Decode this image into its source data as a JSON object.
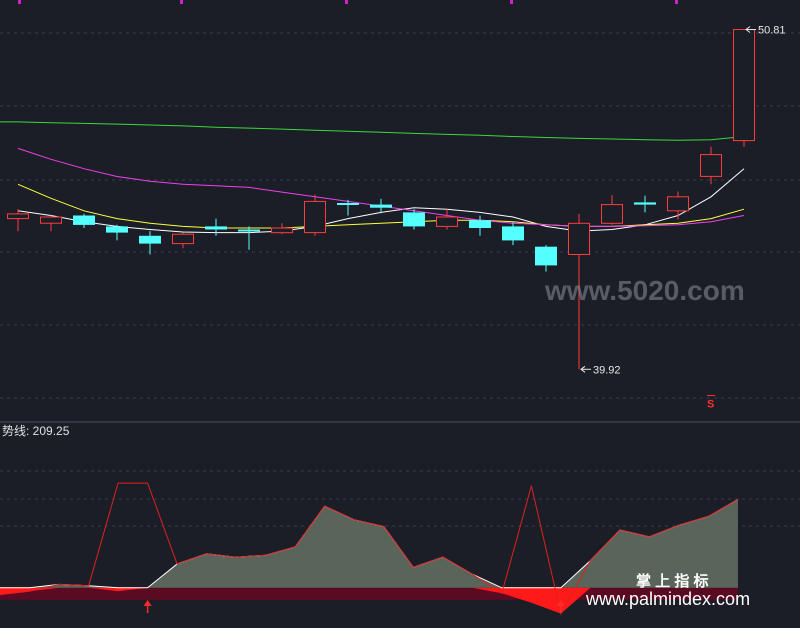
{
  "chart_data": [
    {
      "type": "candlestick",
      "title": "",
      "xlabel": "",
      "ylabel": "",
      "ylim": [
        39.0,
        51.5
      ],
      "grid": true,
      "candles": [
        {
          "open": 44.75,
          "close": 44.9,
          "high": 45.05,
          "low": 44.35
        },
        {
          "open": 44.6,
          "close": 44.8,
          "high": 44.85,
          "low": 44.35
        },
        {
          "open": 44.85,
          "close": 44.55,
          "high": 44.9,
          "low": 44.45
        },
        {
          "open": 44.5,
          "close": 44.3,
          "high": 44.55,
          "low": 44.05
        },
        {
          "open": 44.2,
          "close": 43.95,
          "high": 44.35,
          "low": 43.6
        },
        {
          "open": 43.95,
          "close": 44.25,
          "high": 44.3,
          "low": 43.8
        },
        {
          "open": 44.5,
          "close": 44.4,
          "high": 44.75,
          "low": 44.2
        },
        {
          "open": 44.4,
          "close": 44.38,
          "high": 44.5,
          "low": 43.75
        },
        {
          "open": 44.3,
          "close": 44.45,
          "high": 44.6,
          "low": 44.25
        },
        {
          "open": 44.3,
          "close": 45.3,
          "high": 45.52,
          "low": 44.2
        },
        {
          "open": 45.25,
          "close": 45.2,
          "high": 45.35,
          "low": 44.85
        },
        {
          "open": 45.2,
          "close": 45.1,
          "high": 45.38,
          "low": 44.92
        },
        {
          "open": 44.95,
          "close": 44.5,
          "high": 45.05,
          "low": 44.4
        },
        {
          "open": 44.5,
          "close": 44.8,
          "high": 45.05,
          "low": 44.4
        },
        {
          "open": 44.7,
          "close": 44.45,
          "high": 44.85,
          "low": 44.2
        },
        {
          "open": 44.5,
          "close": 44.05,
          "high": 44.65,
          "low": 43.9
        },
        {
          "open": 43.85,
          "close": 43.25,
          "high": 43.9,
          "low": 43.05
        },
        {
          "open": 43.6,
          "close": 44.6,
          "high": 44.9,
          "low": 39.92
        },
        {
          "open": 44.6,
          "close": 45.2,
          "high": 45.5,
          "low": 44.55
        },
        {
          "open": 45.27,
          "close": 45.2,
          "high": 45.48,
          "low": 44.95
        },
        {
          "open": 45.0,
          "close": 45.45,
          "high": 45.62,
          "low": 44.72
        },
        {
          "open": 46.1,
          "close": 46.8,
          "high": 47.05,
          "low": 45.85
        },
        {
          "open": 47.25,
          "close": 50.81,
          "high": 50.81,
          "low": 47.05
        }
      ],
      "moving_averages": [
        {
          "color": "#ffffff",
          "values": [
            45.0,
            44.85,
            44.65,
            44.5,
            44.4,
            44.32,
            44.3,
            44.3,
            44.35,
            44.5,
            44.75,
            44.95,
            45.1,
            45.05,
            44.95,
            44.8,
            44.5,
            44.35,
            44.4,
            44.55,
            44.85,
            45.45,
            46.35
          ]
        },
        {
          "color": "#ffff3c",
          "values": [
            45.85,
            45.4,
            45.0,
            44.75,
            44.6,
            44.5,
            44.45,
            44.45,
            44.45,
            44.5,
            44.55,
            44.6,
            44.65,
            44.7,
            44.7,
            44.65,
            44.55,
            44.5,
            44.5,
            44.55,
            44.6,
            44.75,
            45.05
          ]
        },
        {
          "color": "#ee40ee",
          "values": [
            47.0,
            46.65,
            46.35,
            46.1,
            45.95,
            45.85,
            45.8,
            45.75,
            45.6,
            45.45,
            45.3,
            45.15,
            45.0,
            44.85,
            44.7,
            44.6,
            44.55,
            44.5,
            44.5,
            44.52,
            44.55,
            44.65,
            44.85
          ]
        },
        {
          "color": "#3cd83c",
          "values": [
            47.85,
            47.82,
            47.8,
            47.78,
            47.75,
            47.72,
            47.68,
            47.65,
            47.62,
            47.58,
            47.55,
            47.52,
            47.48,
            47.45,
            47.42,
            47.38,
            47.35,
            47.32,
            47.3,
            47.28,
            47.26,
            47.28,
            47.38
          ]
        }
      ],
      "annotations": [
        {
          "text": "50.81",
          "candle": 22,
          "value": 50.81,
          "color": "#e8e8e8"
        },
        {
          "text": "39.92",
          "candle": 17,
          "value": 39.92,
          "color": "#e8e8e8"
        },
        {
          "text": "S",
          "candle": 21,
          "value": 39.4,
          "color": "#ff3030"
        }
      ]
    },
    {
      "type": "area",
      "title": "势线: 209.25",
      "xlabel": "",
      "ylabel": "",
      "ylim": [
        -40,
        210
      ],
      "grid": true,
      "baseline": 0,
      "values": [
        -10,
        -5,
        5,
        3,
        -5,
        0,
        35,
        50,
        45,
        48,
        60,
        120,
        100,
        90,
        30,
        45,
        20,
        -8,
        -22,
        -38,
        40,
        85,
        75,
        92,
        105,
        130
      ],
      "signal_line": [
        -10,
        -5,
        5,
        3,
        154,
        154,
        35,
        50,
        45,
        48,
        60,
        120,
        100,
        90,
        30,
        45,
        20,
        -8,
        150,
        -38,
        40,
        85,
        75,
        92,
        105,
        130
      ],
      "buy_markers": [
        5,
        19
      ],
      "watermark_right": "掌 上 指 标"
    }
  ],
  "watermarks": {
    "top": "www.5020.com",
    "bottom": "www.palmindex.com"
  }
}
